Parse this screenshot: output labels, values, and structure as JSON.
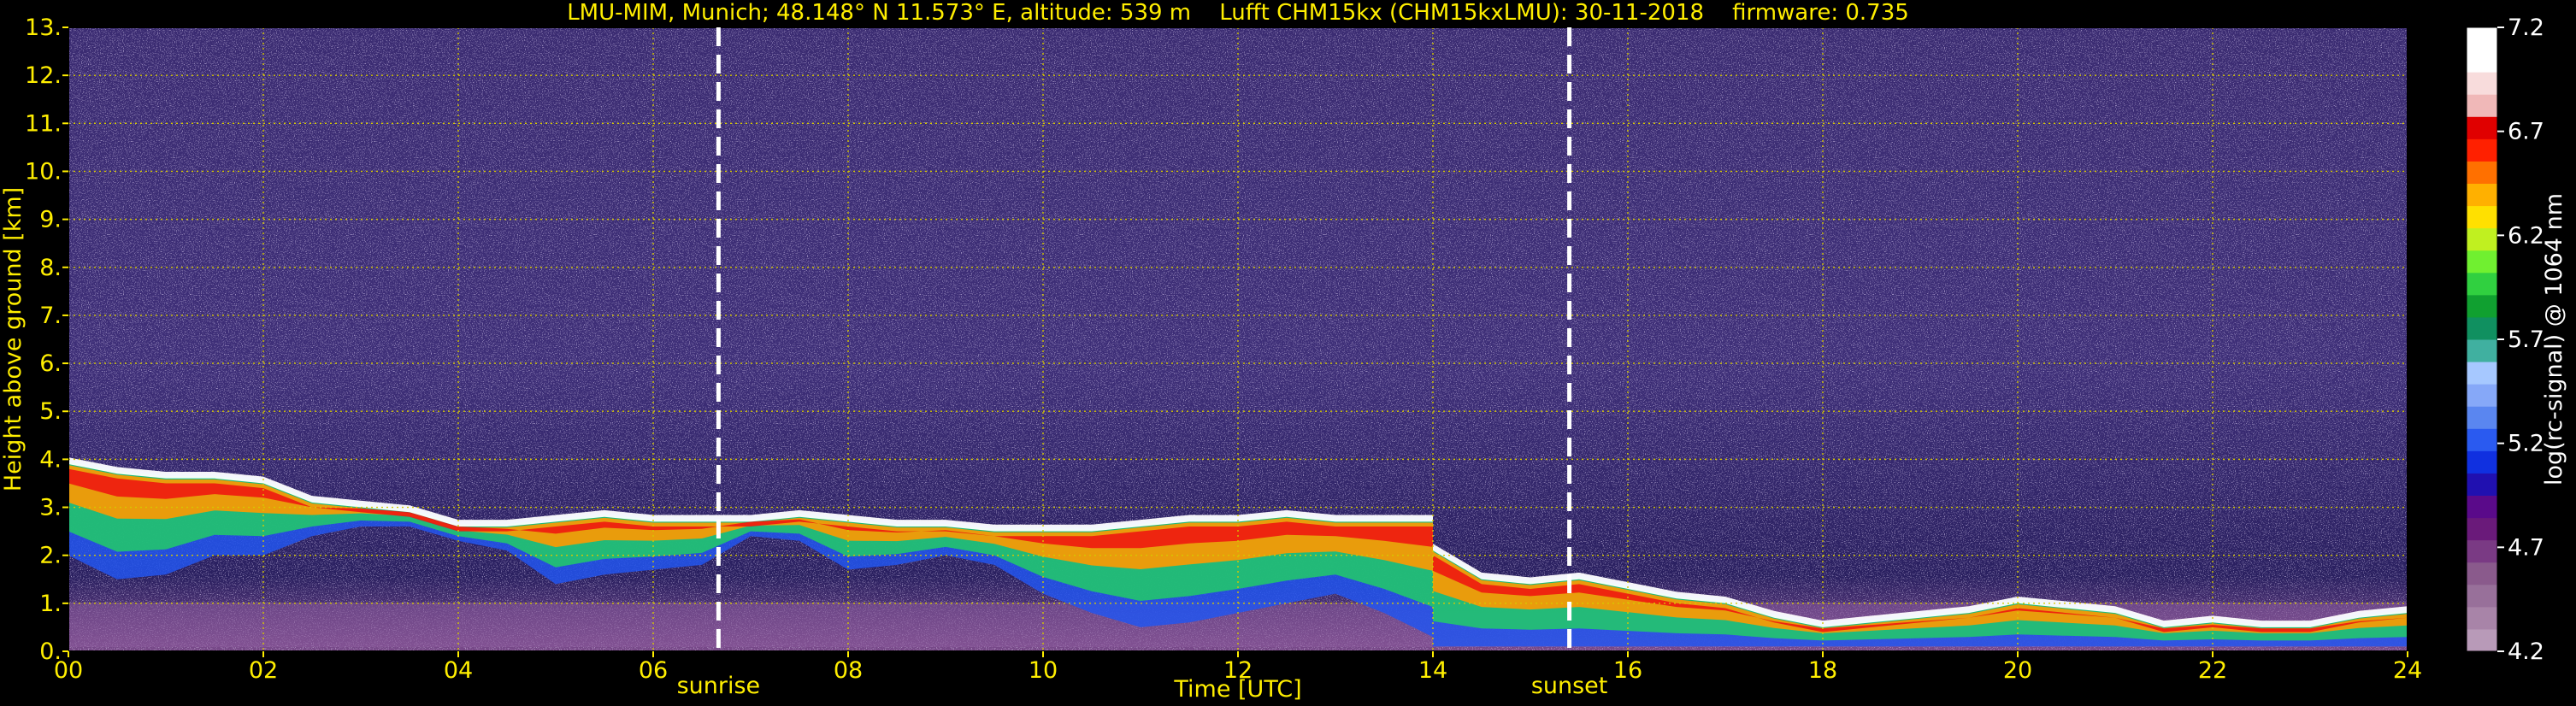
{
  "chart_data": {
    "type": "heatmap",
    "title": "LMU-MIM, Munich; 48.148° N 11.573° E, altitude: 539 m    Lufft CHM15kx (CHM15kxLMU): 30-11-2018    firmware: 0.735",
    "xlabel": "Time [UTC]",
    "ylabel": "Height above ground [km]",
    "xlim": [
      0,
      24
    ],
    "ylim": [
      0,
      13
    ],
    "x_ticks": [
      0,
      2,
      4,
      6,
      8,
      10,
      12,
      14,
      16,
      18,
      20,
      22,
      24
    ],
    "x_tick_labels": [
      "00",
      "02",
      "04",
      "06",
      "08",
      "10",
      "12",
      "14",
      "16",
      "18",
      "20",
      "22",
      "24"
    ],
    "y_ticks": [
      0,
      1,
      2,
      3,
      4,
      5,
      6,
      7,
      8,
      9,
      10,
      11,
      12,
      13
    ],
    "y_tick_labels": [
      "0.",
      "1.",
      "2.",
      "3.",
      "4.",
      "5.",
      "6.",
      "7.",
      "8.",
      "9.",
      "10.",
      "11.",
      "12.",
      "13."
    ],
    "grid": true,
    "markers": [
      {
        "label": "sunrise",
        "x": 6.67
      },
      {
        "label": "sunset",
        "x": 15.4
      }
    ],
    "colorbar": {
      "label": "log(rc-signal) @ 1064 nm",
      "range": [
        4.2,
        7.2
      ],
      "ticks": [
        4.2,
        4.7,
        5.2,
        5.7,
        6.2,
        6.7,
        7.2
      ],
      "tick_labels": [
        "4.2",
        "4.7",
        "5.2",
        "5.7",
        "6.2",
        "6.7",
        "7.2"
      ]
    },
    "layers": [
      {
        "t": [
          0.0,
          0.5,
          1.0,
          1.5,
          2.0,
          2.5,
          3.0,
          3.5,
          4.0,
          4.5,
          5.0,
          5.5,
          6.0,
          6.5,
          7.0,
          7.5,
          8.0,
          8.5,
          9.0,
          9.5,
          10.0,
          10.5,
          11.0,
          11.5,
          12.0,
          12.5,
          13.0,
          13.5,
          14.0
        ],
        "top": [
          4.0,
          3.8,
          3.7,
          3.7,
          3.6,
          3.2,
          3.1,
          3.0,
          2.7,
          2.7,
          2.8,
          2.9,
          2.8,
          2.8,
          2.8,
          2.9,
          2.8,
          2.7,
          2.7,
          2.6,
          2.6,
          2.6,
          2.7,
          2.8,
          2.8,
          2.9,
          2.8,
          2.8,
          2.8
        ],
        "bottom": [
          2.0,
          1.5,
          1.6,
          2.0,
          2.0,
          2.4,
          2.6,
          2.6,
          2.3,
          2.1,
          1.4,
          1.6,
          1.7,
          1.8,
          2.4,
          2.3,
          1.7,
          1.8,
          2.0,
          1.8,
          1.2,
          0.8,
          0.5,
          0.6,
          0.8,
          1.0,
          1.2,
          0.8,
          0.3
        ]
      },
      {
        "t": [
          14.0,
          14.5,
          15.0,
          15.5,
          16.0,
          16.5,
          17.0,
          17.5,
          18.0,
          18.5,
          19.0,
          19.5,
          20.0,
          20.5,
          21.0,
          21.5,
          22.0,
          22.5,
          23.0,
          23.5,
          24.0
        ],
        "top": [
          2.2,
          1.6,
          1.5,
          1.6,
          1.4,
          1.2,
          1.1,
          0.8,
          0.6,
          0.7,
          0.8,
          0.9,
          1.1,
          1.0,
          0.9,
          0.6,
          0.7,
          0.6,
          0.6,
          0.8,
          0.9
        ],
        "bottom": [
          0.1,
          0.1,
          0.1,
          0.1,
          0.1,
          0.1,
          0.1,
          0.1,
          0.1,
          0.1,
          0.1,
          0.1,
          0.1,
          0.1,
          0.1,
          0.1,
          0.1,
          0.1,
          0.1,
          0.1,
          0.1
        ]
      }
    ]
  }
}
